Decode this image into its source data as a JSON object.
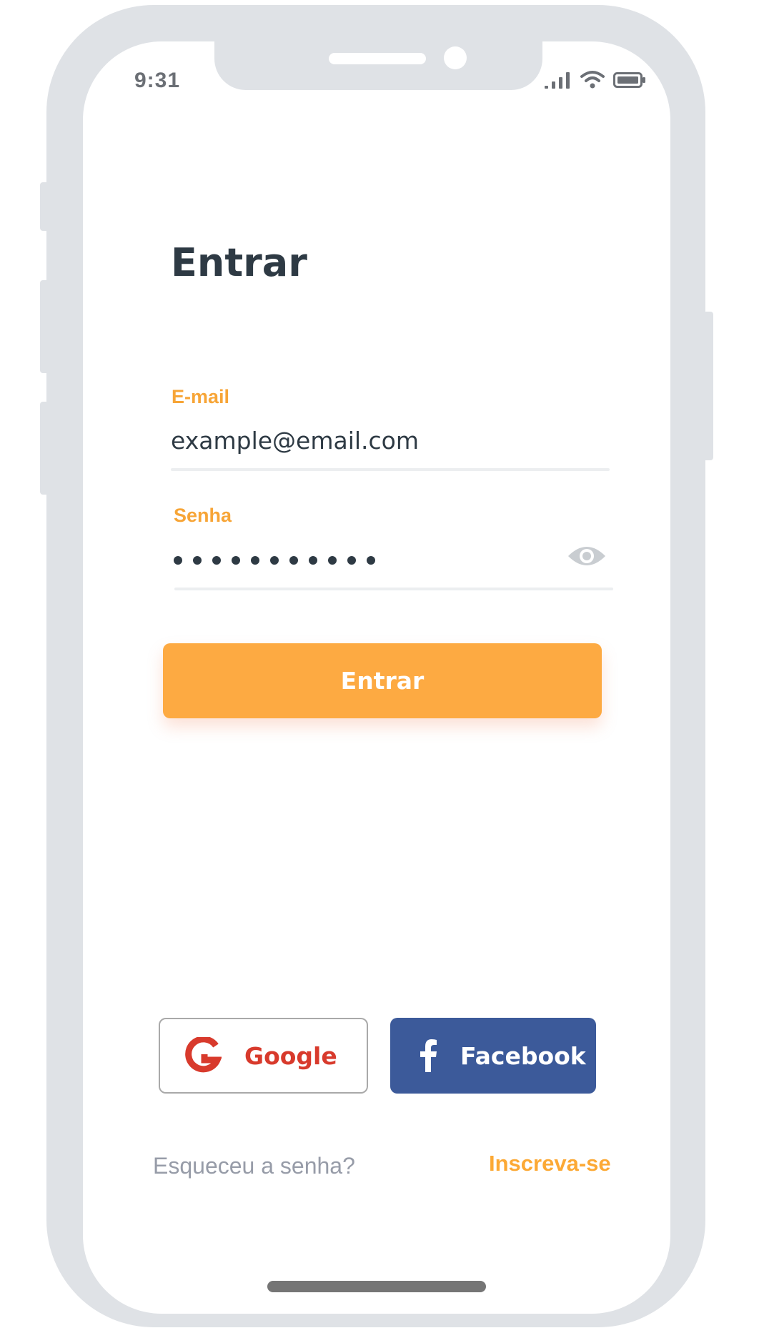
{
  "status_bar": {
    "time": "9:31",
    "icons": [
      "signal-icon",
      "wifi-icon",
      "battery-icon"
    ]
  },
  "login": {
    "title": "Entrar",
    "email": {
      "label": "E-mail",
      "value": "example@email.com"
    },
    "password": {
      "label": "Senha",
      "masked_length": 11,
      "toggle_icon": "eye-icon"
    },
    "submit_label": "Entrar"
  },
  "social": {
    "google_label": "Google",
    "facebook_label": "Facebook"
  },
  "links": {
    "forgot_password": "Esqueceu a senha?",
    "signup": "Inscreva-se"
  },
  "colors": {
    "accent": "#fdaa42",
    "label": "#f7a537",
    "text": "#2e3a44",
    "google": "#d83a2c",
    "facebook": "#3c5a9a",
    "muted": "#979ca8",
    "frame": "#dfe2e6"
  }
}
